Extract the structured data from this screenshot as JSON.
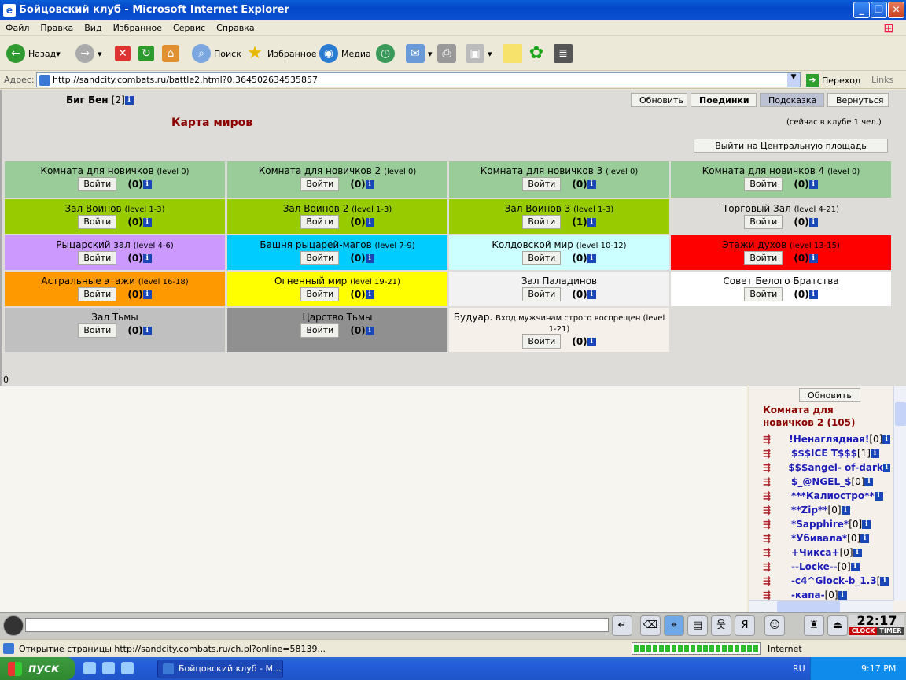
{
  "window": {
    "title": "Бойцовский клуб - Microsoft Internet Explorer"
  },
  "menu": [
    "Файл",
    "Правка",
    "Вид",
    "Избранное",
    "Сервис",
    "Справка"
  ],
  "toolbar": {
    "back": "Назад",
    "search": "Поиск",
    "favorites": "Избранное",
    "media": "Медиа"
  },
  "address": {
    "label": "Адрес:",
    "url": "http://sandcity.combats.ru/battle2.html?0.364502634535857",
    "go": "Переход",
    "links": "Links"
  },
  "page": {
    "user_name": "Биг Бен",
    "user_level": "[2]",
    "buttons": {
      "refresh": "Обновить",
      "fights": "Поединки",
      "hint": "Подсказка",
      "back": "Вернуться"
    },
    "map_title": "Карта миров",
    "online": "(сейчас в клубе 1 чел.)",
    "exit": "Выйти на Центральную площадь",
    "enter": "Войти",
    "rooms": [
      {
        "name": "Комната для новичков",
        "level": "(level 0)",
        "count": "(0)",
        "color": "#99cc99"
      },
      {
        "name": "Комната для новичков 2",
        "level": "(level 0)",
        "count": "(0)",
        "color": "#99cc99"
      },
      {
        "name": "Комната для новичков 3",
        "level": "(level 0)",
        "count": "(0)",
        "color": "#99cc99"
      },
      {
        "name": "Комната для новичков 4",
        "level": "(level 0)",
        "count": "(0)",
        "color": "#99cc99"
      },
      {
        "name": "Зал Воинов",
        "level": "(level 1-3)",
        "count": "(0)",
        "color": "#99cc00"
      },
      {
        "name": "Зал Воинов 2",
        "level": "(level 1-3)",
        "count": "(0)",
        "color": "#99cc00"
      },
      {
        "name": "Зал Воинов 3",
        "level": "(level 1-3)",
        "count": "(1)",
        "color": "#99cc00"
      },
      {
        "name": "Торговый Зал",
        "level": "(level 4-21)",
        "count": "(0)",
        "color": "#dedcd8"
      },
      {
        "name": "Рыцарский зал",
        "level": "(level 4-6)",
        "count": "(0)",
        "color": "#cc99ff"
      },
      {
        "name": "Башня рыцарей-магов",
        "level": "(level 7-9)",
        "count": "(0)",
        "color": "#00ccff"
      },
      {
        "name": "Колдовской мир",
        "level": "(level 10-12)",
        "count": "(0)",
        "color": "#ccffff"
      },
      {
        "name": "Этажи духов",
        "level": "(level 13-15)",
        "count": "(0)",
        "color": "#ff0000"
      },
      {
        "name": "Астральные этажи",
        "level": "(level 16-18)",
        "count": "(0)",
        "color": "#ff9900"
      },
      {
        "name": "Огненный мир",
        "level": "(level 19-21)",
        "count": "(0)",
        "color": "#ffff00"
      },
      {
        "name": "Зал Паладинов",
        "level": "",
        "count": "(0)",
        "color": "#f2f2f2"
      },
      {
        "name": "Совет Белого Братства",
        "level": "",
        "count": "(0)",
        "color": "#ffffff"
      },
      {
        "name": "Зал Тьмы",
        "level": "",
        "count": "(0)",
        "color": "#c0c0c0"
      },
      {
        "name": "Царство Тьмы",
        "level": "",
        "count": "(0)",
        "color": "#909090"
      },
      {
        "name": "Будуар.",
        "level": "Вход мужчинам строго воспрещен (level 1-21)",
        "count": "(0)",
        "color": "#f6f0eb"
      }
    ],
    "zero": "0"
  },
  "sidebar": {
    "refresh": "Обновить",
    "room_title": "Комната для новичков 2 (105)",
    "users": [
      {
        "name": "!Ненаглядная!",
        "level": "[0]"
      },
      {
        "name": "$$$ICE T$$$",
        "level": "[1]"
      },
      {
        "name": "$$$angel- of-dark",
        "level": ""
      },
      {
        "name": "$_@NGEL_$",
        "level": "[0]"
      },
      {
        "name": "***Калиостро**",
        "level": ""
      },
      {
        "name": "**Zip**",
        "level": "[0]"
      },
      {
        "name": "*Sapphire*",
        "level": "[0]"
      },
      {
        "name": "*Убивала*",
        "level": "[0]"
      },
      {
        "name": "+Чикса+",
        "level": "[0]"
      },
      {
        "name": "--Locke--",
        "level": "[0]"
      },
      {
        "name": "-c4^Glock-b_1.3",
        "level": "["
      },
      {
        "name": "-капа-",
        "level": "[0]"
      }
    ]
  },
  "clock": {
    "time": "22:17",
    "clock": "CLOCK",
    "timer": "TIMER"
  },
  "status": {
    "text": "Открытие страницы http://sandcity.combats.ru/ch.pl?online=58139...",
    "zone": "Internet"
  },
  "taskbar": {
    "start": "пуск",
    "task": "Бойцовский клуб - M...",
    "lang": "RU",
    "time": "9:17 PM"
  }
}
